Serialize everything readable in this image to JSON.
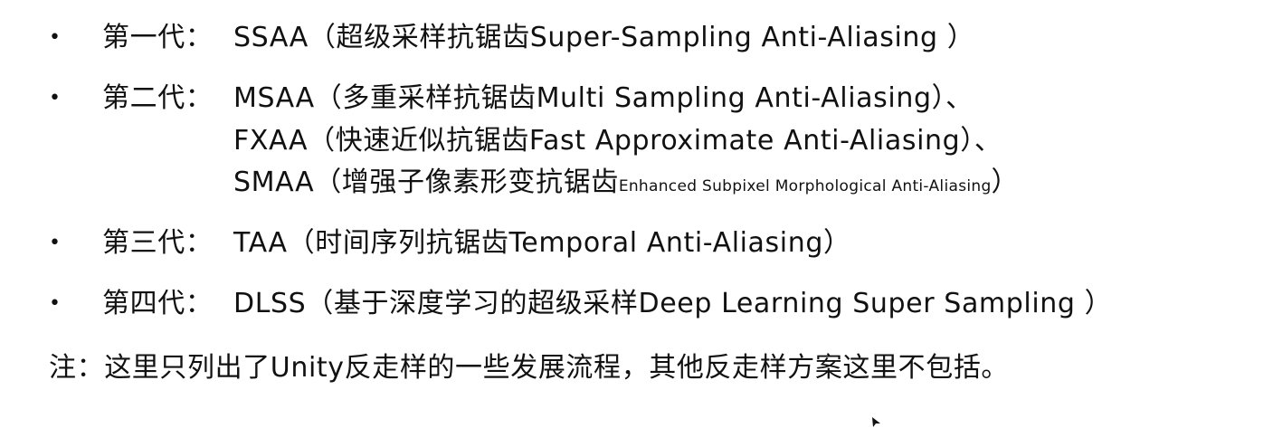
{
  "bullet_char": "•",
  "items": [
    {
      "label": "第一代：",
      "text": "SSAA（超级采样抗锯齿Super-Sampling Anti-Aliasing ）"
    },
    {
      "label": "第二代：",
      "text": "MSAA（多重采样抗锯齿Multi Sampling Anti-Aliasing）、"
    },
    {
      "label": "",
      "text": "FXAA（快速近似抗锯齿Fast Approximate Anti-Aliasing）、"
    },
    {
      "label": "",
      "text_main": "SMAA（增强子像素形变抗锯齿",
      "text_small": "Enhanced Subpixel Morphological Anti-Aliasing",
      "text_end": "）"
    },
    {
      "label": "第三代：",
      "text": "TAA（时间序列抗锯齿Temporal Anti-Aliasing）"
    },
    {
      "label": "第四代：",
      "text": "DLSS（基于深度学习的超级采样Deep Learning Super Sampling ）"
    }
  ],
  "note": "注：这里只列出了Unity反走样的一些发展流程，其他反走样方案这里不包括。"
}
